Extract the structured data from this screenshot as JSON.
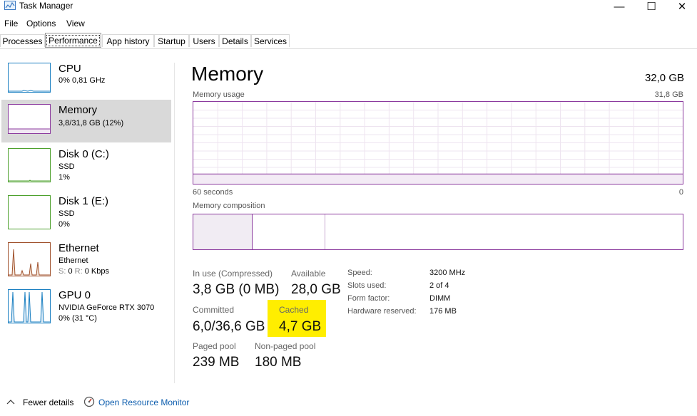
{
  "window": {
    "title": "Task Manager",
    "controls": {
      "minimize": "—",
      "maximize": "☐",
      "close": "✕"
    }
  },
  "menu": [
    "File",
    "Options",
    "View"
  ],
  "tabs": [
    "Processes",
    "Performance",
    "App history",
    "Startup",
    "Users",
    "Details",
    "Services"
  ],
  "active_tab": "Performance",
  "sidebar": {
    "items": [
      {
        "name": "CPU",
        "line1": "0% 0,81 GHz",
        "line2": "",
        "color": "#1a7fc1"
      },
      {
        "name": "Memory",
        "line1": "3,8/31,8 GB (12%)",
        "line2": "",
        "color": "#8b3a9e"
      },
      {
        "name": "Disk 0 (C:)",
        "line1": "SSD",
        "line2": "1%",
        "color": "#4ca02c"
      },
      {
        "name": "Disk 1 (E:)",
        "line1": "SSD",
        "line2": "0%",
        "color": "#4ca02c"
      },
      {
        "name": "Ethernet",
        "line1": "Ethernet",
        "line2_s": "S:",
        "line2_sv": "0",
        "line2_r": "R:",
        "line2_rv": "0 Kbps",
        "color": "#a0522d"
      },
      {
        "name": "GPU 0",
        "line1": "NVIDIA GeForce RTX 3070",
        "line2": "0% (31 °C)",
        "color": "#1a7fc1"
      }
    ]
  },
  "main": {
    "title": "Memory",
    "total": "32,0 GB",
    "usage_label": "Memory usage",
    "usage_max": "31,8 GB",
    "time_left": "60 seconds",
    "time_right": "0",
    "composition_label": "Memory composition",
    "usage_fraction": 0.12,
    "stats": {
      "in_use_label": "In use (Compressed)",
      "in_use_value": "3,8 GB (0 MB)",
      "available_label": "Available",
      "available_value": "28,0 GB",
      "committed_label": "Committed",
      "committed_value": "6,0/36,6 GB",
      "cached_label": "Cached",
      "cached_value": "4,7 GB",
      "paged_label": "Paged pool",
      "paged_value": "239 MB",
      "nonpaged_label": "Non-paged pool",
      "nonpaged_value": "180 MB"
    },
    "details": [
      {
        "label": "Speed:",
        "value": "3200 MHz"
      },
      {
        "label": "Slots used:",
        "value": "2 of 4"
      },
      {
        "label": "Form factor:",
        "value": "DIMM"
      },
      {
        "label": "Hardware reserved:",
        "value": "176 MB"
      }
    ],
    "accent_color": "#8b3a9e",
    "highlight_color": "#ffee00"
  },
  "footer": {
    "fewer_details": "Fewer details",
    "open_resource_monitor": "Open Resource Monitor"
  }
}
